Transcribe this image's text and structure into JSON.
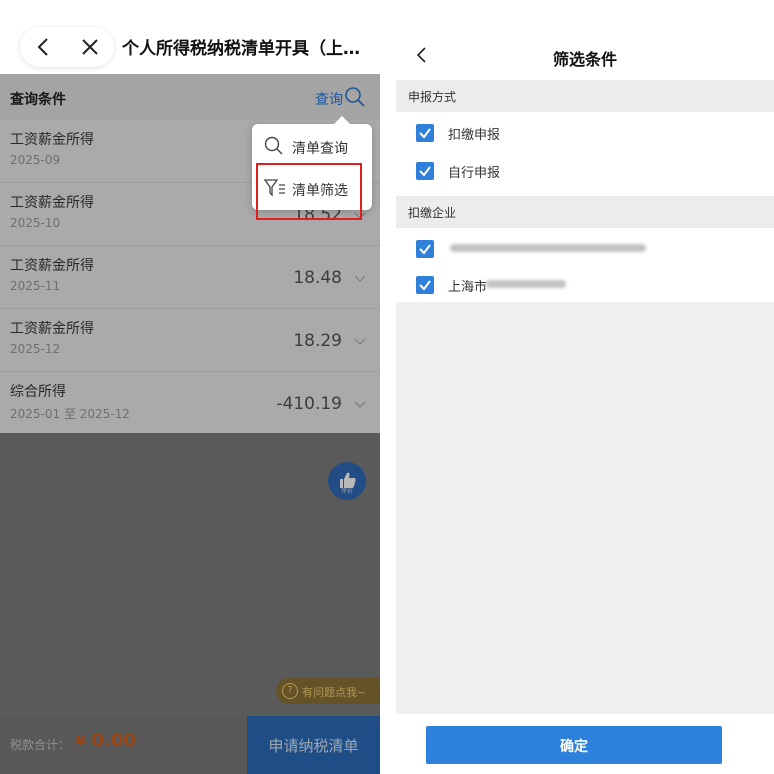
{
  "left": {
    "title": "个人所得税纳税清单开具（上…",
    "query_bar": {
      "label": "查询条件",
      "link": "查询"
    },
    "rows": [
      {
        "title": "工资薪金所得",
        "sub": "2025-09",
        "value": ""
      },
      {
        "title": "工资薪金所得",
        "sub": "2025-10",
        "value": "18.52"
      },
      {
        "title": "工资薪金所得",
        "sub": "2025-11",
        "value": "18.48"
      },
      {
        "title": "工资薪金所得",
        "sub": "2025-12",
        "value": "18.29"
      },
      {
        "title": "综合所得",
        "sub": "2025-01 至 2025-12",
        "value": "-410.19"
      }
    ],
    "popup": {
      "item1": "清单查询",
      "item2": "清单筛选"
    },
    "help": "有问题点我~",
    "thumb_label": "评价",
    "tax_total_label": "税款合计：",
    "tax_total_currency": "¥",
    "tax_total_value": "0.00",
    "apply_button": "申请纳税清单"
  },
  "right": {
    "title": "筛选条件",
    "section1": "申报方式",
    "options1": [
      "扣缴申报",
      "自行申报"
    ],
    "section2": "扣缴企业",
    "company2_prefix": "上海市",
    "confirm_button": "确定"
  },
  "colors": {
    "accent": "#2f80db",
    "red_highlight": "#e0201c",
    "amount": "#d3641f"
  },
  "icons": [
    "back-icon",
    "close-icon",
    "search-icon",
    "filter-icon",
    "chevron-down-icon",
    "thumbs-up-icon",
    "help-icon",
    "checkbox-checked-icon"
  ]
}
